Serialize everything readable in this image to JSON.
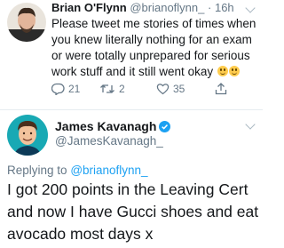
{
  "tweet1": {
    "author_name": "Brian O'Flynn",
    "author_handle": "@brianoflynn_",
    "separator": "·",
    "time": "16h",
    "text": "Please tweet me stories of times when you knew literally nothing for an exam or were totally unprepared for serious work stuff and it still went okay",
    "replies": "21",
    "retweets": "2",
    "likes": "35"
  },
  "tweet2": {
    "author_name": "James Kavanagh",
    "author_handle": "@JamesKavanagh_",
    "replying_prefix": "Replying to",
    "replying_to": "@brianoflynn_",
    "text": "I got 200 points in the Leaving Cert and now I have Gucci shoes and eat avocado most days x"
  },
  "colors": {
    "link": "#1da1f2",
    "secondary_text": "#657786",
    "primary_text": "#14171a",
    "divider": "#e6ecf0",
    "verified": "#1da1f2"
  },
  "icons": [
    "reply-icon",
    "retweet-icon",
    "like-icon",
    "share-icon",
    "verified-badge-icon",
    "chevron-down-icon",
    "smiling-face-emoji"
  ]
}
